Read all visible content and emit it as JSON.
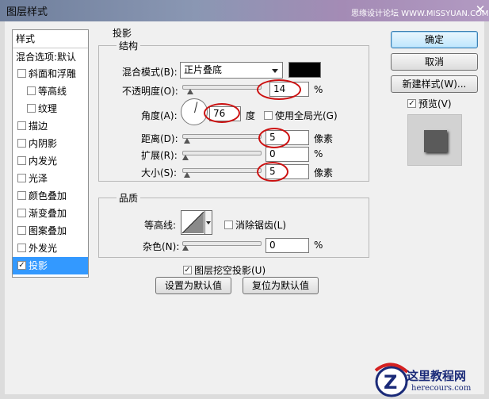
{
  "window": {
    "title": "图层样式",
    "watermark_top": "思缘设计论坛 WWW.MISSYUAN.COM",
    "close_glyph": "✕"
  },
  "style_list": {
    "header": "样式",
    "blend_options": "混合选项:默认",
    "items": [
      {
        "label": "斜面和浮雕",
        "checked": false,
        "indent": false
      },
      {
        "label": "等高线",
        "checked": false,
        "indent": true
      },
      {
        "label": "纹理",
        "checked": false,
        "indent": true
      },
      {
        "label": "描边",
        "checked": false,
        "indent": false
      },
      {
        "label": "内阴影",
        "checked": false,
        "indent": false
      },
      {
        "label": "内发光",
        "checked": false,
        "indent": false
      },
      {
        "label": "光泽",
        "checked": false,
        "indent": false
      },
      {
        "label": "颜色叠加",
        "checked": false,
        "indent": false
      },
      {
        "label": "渐变叠加",
        "checked": false,
        "indent": false
      },
      {
        "label": "图案叠加",
        "checked": false,
        "indent": false
      },
      {
        "label": "外发光",
        "checked": false,
        "indent": false
      },
      {
        "label": "投影",
        "checked": true,
        "indent": false,
        "selected": true
      }
    ]
  },
  "drop_shadow": {
    "section_title": "投影",
    "structure": {
      "title": "结构",
      "blend_mode_label": "混合模式(B):",
      "blend_mode_value": "正片叠底",
      "shadow_color": "#000000",
      "opacity_label": "不透明度(O):",
      "opacity_value": "14",
      "opacity_unit": "%",
      "angle_label": "角度(A):",
      "angle_value": "76",
      "angle_unit": "度",
      "global_light_label": "使用全局光(G)",
      "global_light_checked": false,
      "distance_label": "距离(D):",
      "distance_value": "5",
      "distance_unit": "像素",
      "spread_label": "扩展(R):",
      "spread_value": "0",
      "spread_unit": "%",
      "size_label": "大小(S):",
      "size_value": "5",
      "size_unit": "像素"
    },
    "quality": {
      "title": "品质",
      "contour_label": "等高线:",
      "antialias_label": "消除锯齿(L)",
      "antialias_checked": false,
      "noise_label": "杂色(N):",
      "noise_value": "0",
      "noise_unit": "%"
    },
    "knockout_label": "图层挖空投影(U)",
    "knockout_checked": true,
    "make_default_label": "设置为默认值",
    "reset_default_label": "复位为默认值"
  },
  "buttons": {
    "ok": "确定",
    "cancel": "取消",
    "new_style": "新建样式(W)...",
    "preview_label": "预览(V)",
    "preview_checked": true
  },
  "watermark_bottom": {
    "name": "这里教程网",
    "url": "herecours.com"
  },
  "colors": {
    "highlight": "#cc1111",
    "selection": "#3399ff"
  }
}
